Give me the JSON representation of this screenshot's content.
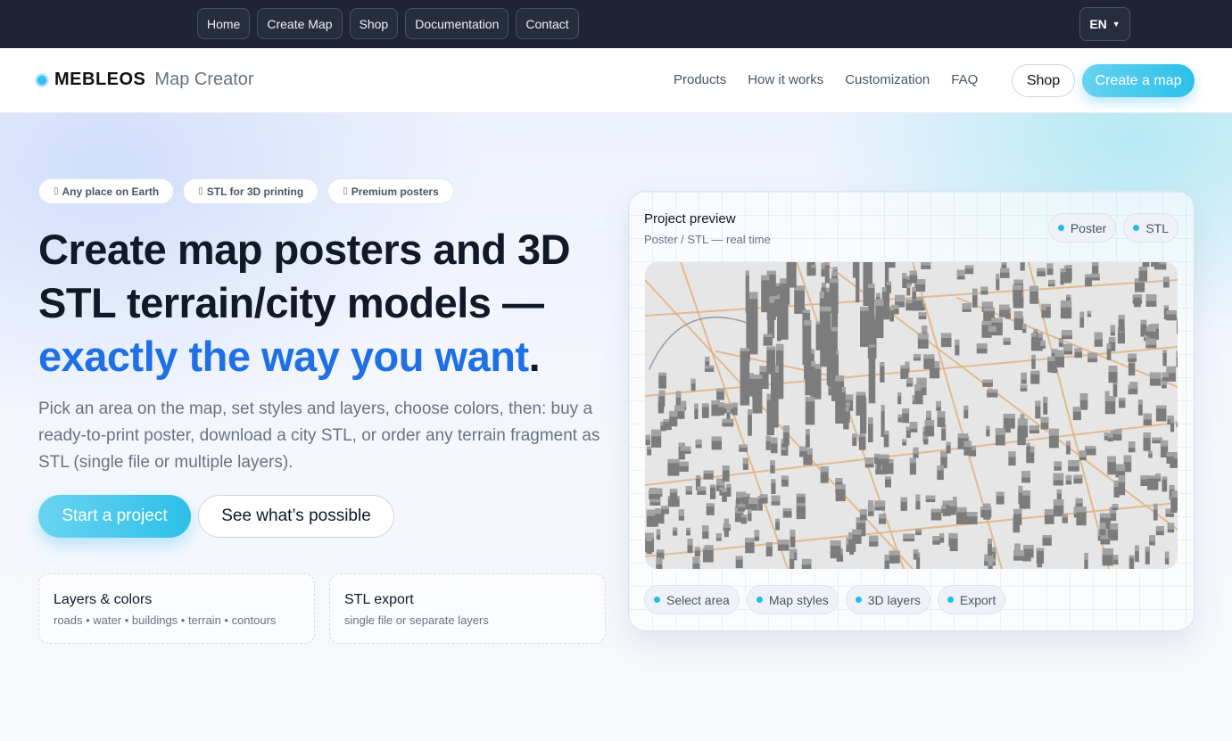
{
  "topnav": {
    "items": [
      "Home",
      "Create Map",
      "Shop",
      "Documentation",
      "Contact"
    ],
    "language": "EN"
  },
  "header": {
    "brand_name": "MEBLEOS",
    "brand_sub": "Map Creator",
    "nav": [
      "Products",
      "How it works",
      "Customization",
      "FAQ"
    ],
    "shop_label": "Shop",
    "create_label": "Create a map"
  },
  "hero": {
    "pills": [
      {
        "icon": "globe-icon",
        "label": "Any place on Earth"
      },
      {
        "icon": "cube-icon",
        "label": "STL for 3D printing"
      },
      {
        "icon": "frame-icon",
        "label": "Premium posters"
      }
    ],
    "headline_line1": "Create map posters and 3D",
    "headline_line2": "STL terrain/city models —",
    "headline_highlight": "exactly the way you want",
    "headline_end": ".",
    "lead": "Pick an area on the map, set styles and layers, choose colors, then: buy a ready-to-print poster, download a city STL, or order any terrain fragment as STL (single file or multiple layers).",
    "primary_cta": "Start a project",
    "secondary_cta": "See what’s possible",
    "cards": [
      {
        "title": "Layers & colors",
        "subtitle": "roads • water • buildings • terrain • contours"
      },
      {
        "title": "STL export",
        "subtitle": "single file or separate layers"
      }
    ]
  },
  "preview": {
    "title": "Project preview",
    "subtitle": "Poster / STL — real time",
    "tags": [
      "Poster",
      "STL"
    ],
    "steps": [
      "Select area",
      "Map styles",
      "3D layers",
      "Export"
    ]
  },
  "colors": {
    "accent": "#2cbfe8",
    "headline_blue": "#1f6fe5",
    "topbar": "#1e2433",
    "road": "#e0b27f"
  }
}
